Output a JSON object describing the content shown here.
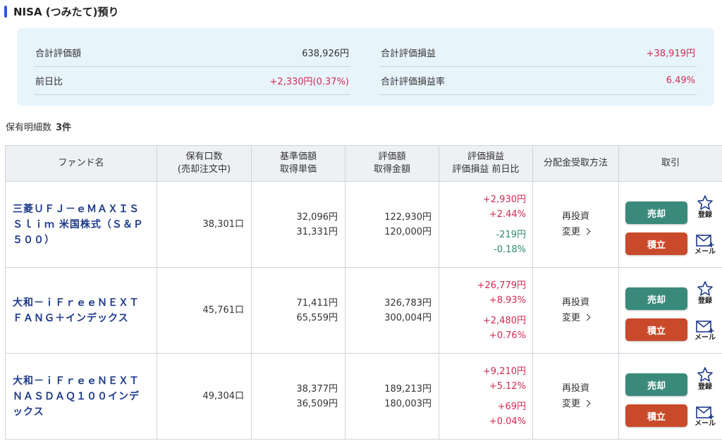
{
  "section": {
    "title": "NISA (つみたて)預り"
  },
  "summary": {
    "left": [
      {
        "label": "合計評価額",
        "value": "638,926円",
        "tone": "normal"
      },
      {
        "label": "前日比",
        "value": "+2,330円(0.37%)",
        "tone": "red"
      }
    ],
    "right": [
      {
        "label": "合計評価損益",
        "value": "+38,919円",
        "tone": "red"
      },
      {
        "label": "合計評価損益率",
        "value": "6.49%",
        "tone": "red"
      }
    ]
  },
  "holdings": {
    "label": "保有明細数",
    "count": "3件"
  },
  "table": {
    "headers": {
      "fund": "ファンド名",
      "units_1": "保有口数",
      "units_2": "(売却注文中)",
      "price_1": "基準価額",
      "price_2": "取得単価",
      "value_1": "評価額",
      "value_2": "取得金額",
      "pl_1": "評価損益",
      "pl_2": "評価損益 前日比",
      "dist": "分配金受取方法",
      "trade": "取引"
    },
    "rows": [
      {
        "fund": "三菱ＵＦＪ－ｅＭＡＸＩＳ Ｓｌｉｍ 米国株式（Ｓ＆Ｐ５００）",
        "units": "38,301口",
        "nav": "32,096円",
        "cost_unit": "31,331円",
        "value": "122,930円",
        "cost": "120,000円",
        "pl_amount": "+2,930円",
        "pl_pct": "+2.44%",
        "day_amount": "-219円",
        "day_pct": "-0.18%",
        "day_tone": "green",
        "dist_method": "再投資",
        "dist_change": "変更"
      },
      {
        "fund": "大和－ｉＦｒｅｅＮＥＸＴ ＦＡＮＧ＋インデックス",
        "units": "45,761口",
        "nav": "71,411円",
        "cost_unit": "65,559円",
        "value": "326,783円",
        "cost": "300,004円",
        "pl_amount": "+26,779円",
        "pl_pct": "+8.93%",
        "day_amount": "+2,480円",
        "day_pct": "+0.76%",
        "day_tone": "red",
        "dist_method": "再投資",
        "dist_change": "変更"
      },
      {
        "fund": "大和－ｉＦｒｅｅＮＥＸＴ ＮＡＳＤＡＱ１００インデックス",
        "units": "49,304口",
        "nav": "38,377円",
        "cost_unit": "36,509円",
        "value": "189,213円",
        "cost": "180,003円",
        "pl_amount": "+9,210円",
        "pl_pct": "+5.12%",
        "day_amount": "+69円",
        "day_pct": "+0.04%",
        "day_tone": "red",
        "dist_method": "再投資",
        "dist_change": "変更"
      }
    ],
    "actions": {
      "sell": "売却",
      "buy": "積立",
      "fav": "登録",
      "mail": "メール"
    }
  },
  "colors": {
    "accent": "#2e5bd6",
    "sell": "#3a8a7c",
    "buy": "#c94a2a",
    "positive": "#d22a52",
    "negative": "#2e8a6e",
    "summary_bg": "#e8f4fc"
  }
}
